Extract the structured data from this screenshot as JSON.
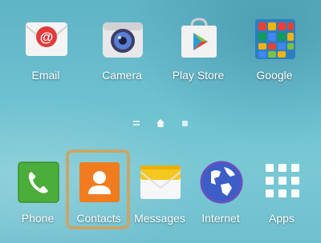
{
  "home_screen": {
    "top_row": [
      {
        "label": "Email",
        "icon": "email-icon"
      },
      {
        "label": "Camera",
        "icon": "camera-icon"
      },
      {
        "label": "Play Store",
        "icon": "play-store-icon"
      },
      {
        "label": "Google",
        "icon": "google-folder-icon"
      }
    ],
    "dock": [
      {
        "label": "Phone",
        "icon": "phone-icon"
      },
      {
        "label": "Contacts",
        "icon": "contacts-icon",
        "highlighted": true
      },
      {
        "label": "Messages",
        "icon": "messages-icon"
      },
      {
        "label": "Internet",
        "icon": "internet-icon"
      },
      {
        "label": "Apps",
        "icon": "apps-grid-icon"
      }
    ],
    "page_indicator": {
      "pages": [
        "menu",
        "home",
        "page-2"
      ],
      "current": "home"
    }
  },
  "colors": {
    "highlight_border": "#c8a66a",
    "email_red": "#e23b3b",
    "contacts_orange": "#f07c1f",
    "phone_green": "#4cae3a",
    "internet_blue": "#3c5ec6"
  }
}
